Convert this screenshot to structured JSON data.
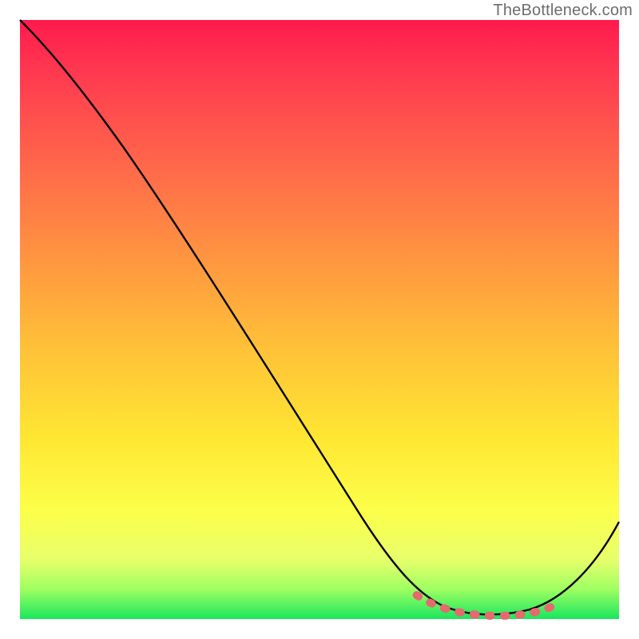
{
  "watermark": "TheBottleneck.com",
  "chart_data": {
    "type": "line",
    "title": "",
    "xlabel": "",
    "ylabel": "",
    "xlim": [
      0,
      100
    ],
    "ylim": [
      0,
      100
    ],
    "grid": false,
    "legend": false,
    "series": [
      {
        "name": "curve",
        "color": "#000000",
        "x": [
          0,
          12,
          25,
          50,
          65,
          70,
          75,
          80,
          85,
          90,
          100
        ],
        "y": [
          100,
          91,
          80,
          40,
          12,
          4,
          1,
          0,
          1,
          5,
          20
        ]
      },
      {
        "name": "valley-marker",
        "color": "#e46a6f",
        "x_range": [
          67,
          90
        ],
        "y": 0
      }
    ],
    "gradient_stops": [
      {
        "pos": 0.0,
        "color": "#ff1a4d"
      },
      {
        "pos": 0.1,
        "color": "#ff3d50"
      },
      {
        "pos": 0.25,
        "color": "#ff6a4a"
      },
      {
        "pos": 0.4,
        "color": "#ff9640"
      },
      {
        "pos": 0.55,
        "color": "#ffc238"
      },
      {
        "pos": 0.7,
        "color": "#ffe733"
      },
      {
        "pos": 0.82,
        "color": "#fcff4a"
      },
      {
        "pos": 0.9,
        "color": "#e8ff6b"
      },
      {
        "pos": 0.95,
        "color": "#9fff62"
      },
      {
        "pos": 1.0,
        "color": "#19e65e"
      }
    ]
  }
}
